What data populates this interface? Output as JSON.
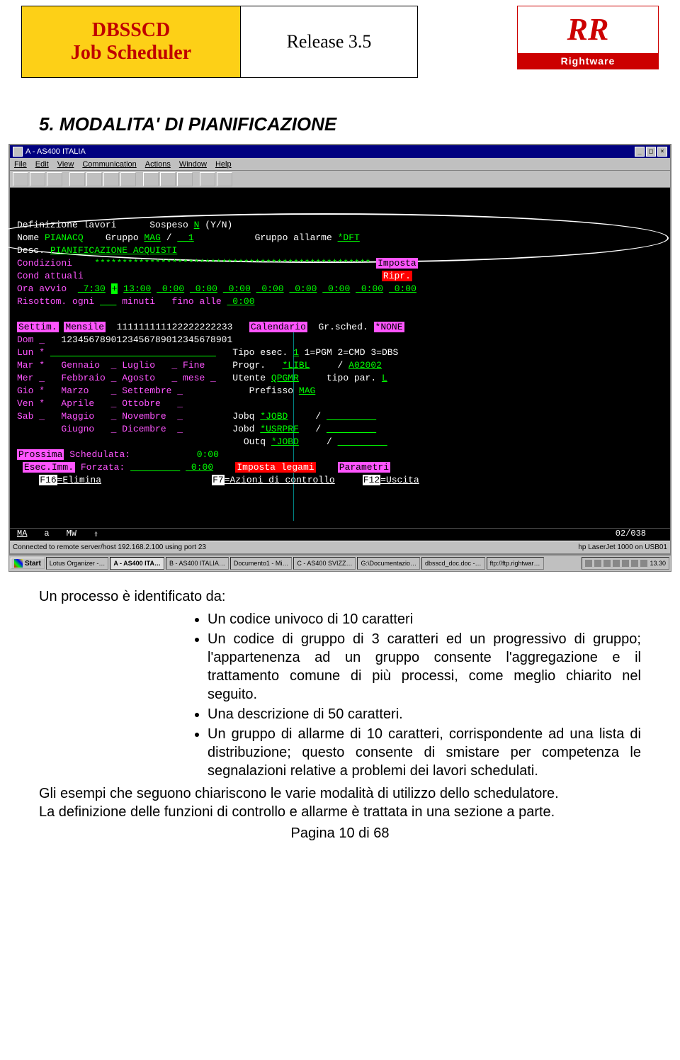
{
  "header": {
    "left_line1": "DBSSCD",
    "left_line2": "Job Scheduler",
    "release": "Release 3.5",
    "logo_r": "RR",
    "logo_text": "Rightware"
  },
  "section_title": "5. MODALITA' DI PIANIFICAZIONE",
  "term": {
    "title": "A - AS400 ITALIA",
    "menu": [
      "File",
      "Edit",
      "View",
      "Communication",
      "Actions",
      "Window",
      "Help"
    ],
    "lines": {
      "l1a": "Definizione lavori",
      "l1b": "Sospeso",
      "l1c": "N",
      "l1d": "(Y/N)",
      "l2a": "Nome",
      "l2b": "PIANACQ",
      "l2c": "Gruppo",
      "l2d": "MAG",
      "l2e": "/",
      "l2f": "  1",
      "l2g": "Gruppo allarme",
      "l2h": "*DFT",
      "l3a": "Desc.",
      "l3b": "PIANIFICAZIONE ACQUISTI",
      "l4a": "Condizioni",
      "l4b": "**************************************************",
      "l4c": "Imposta",
      "l5a": "Cond attuali",
      "l5b": "Ripr.",
      "l6a": "Ora avvio",
      "l6b": " 7:30",
      "l6plus": "+",
      "l6c": "13:00",
      "l6d": " 0:00",
      "l7a": "Risottom. ogni",
      "l7b": "minuti",
      "l7c": "fino alle",
      "l7d": " 0:00",
      "l8a": "Settim.",
      "l8b": "Mensile",
      "l8c": "111111111122222222233",
      "l8d": "Calendario",
      "l8e": "Gr.sched.",
      "l8f": "*NONE",
      "l9a": "Dom _",
      "l9b": "123456789012345678901234567890​1",
      "l10": "Lun *",
      "l10b": "Tipo esec.",
      "l10c": "1",
      "l10d": "1=PGM 2=CMD 3=DBS",
      "l11": "Mar *   Gennaio  _ Luglio   _ Fine",
      "l11b": "Progr.",
      "l11c": "*LIBL",
      "l11d": "/",
      "l11e": "A02002",
      "l12": "Mer _   Febbraio _ Agosto   _ mese _",
      "l12b": "Utente",
      "l12c": "QPGMR",
      "l12d": "tipo par.",
      "l12e": "L",
      "l13": "Gio *   Marzo    _ Settembre _",
      "l13b": "Prefisso",
      "l13c": "MAG",
      "l14": "Ven *   Aprile   _ Ottobre   _",
      "l15": "Sab _   Maggio   _ Novembre  _",
      "l15b": "Jobq",
      "l15c": "*JOBD",
      "l15d": "/",
      "l16": "        Giugno   _ Dicembre  _",
      "l16b": "Jobd",
      "l16c": "*USRPRF",
      "l16d": "/",
      "l17b": "Outq",
      "l17c": "*JOBD",
      "l17d": "/",
      "l18a": "Prossima",
      "l18b": "Schedulata:",
      "l18c": "0:00",
      "l19a": "Esec.Imm.",
      "l19b": "Forzata:",
      "l19c": " 0:00",
      "l19d": "Imposta legami",
      "l19e": "Parametri",
      "l20a": "F16",
      "l20b": "=Elimina",
      "l20c": "F7",
      "l20d": "=Azioni di controllo",
      "l20e": "F12",
      "l20f": "=Uscita"
    },
    "status": {
      "a": "MA",
      "b": "a",
      "c": "MW",
      "arrow": "⇧",
      "pos": "02/038"
    },
    "footer_left": "Connected to remote server/host 192.168.2.100 using port 23",
    "footer_right": "hp LaserJet 1000 on USB01"
  },
  "taskbar": {
    "start": "Start",
    "tasks": [
      "Lotus Organizer -…",
      "A - AS400 ITA…",
      "B - AS400 ITALIA…",
      "Documento1 - Mi…",
      "C - AS400 SVIZZ…",
      "G:\\Documentazio…",
      "dbsscd_doc.doc -…",
      "ftp://ftp.rightwar…"
    ],
    "time": "13.30"
  },
  "body": {
    "intro": "Un processo è identificato da:",
    "bullets": [
      "Un codice univoco di 10 caratteri",
      "Un codice di gruppo di 3 caratteri ed un progressivo di gruppo; l'appartenenza ad un gruppo consente l'aggregazione e il trattamento comune di più processi, come meglio chiarito nel seguito.",
      "Una descrizione di 50 caratteri.",
      "Un gruppo di allarme di 10 caratteri, corrispondente ad una lista di distribuzione; questo consente di smistare per competenza le segnalazioni relative a problemi dei lavori schedulati."
    ],
    "para1": "Gli esempi che seguono chiariscono le varie modalità di utilizzo dello schedulatore.",
    "para2": "La definizione delle funzioni di controllo e allarme è trattata in una sezione a parte.",
    "page": "Pagina 10 di 68"
  }
}
